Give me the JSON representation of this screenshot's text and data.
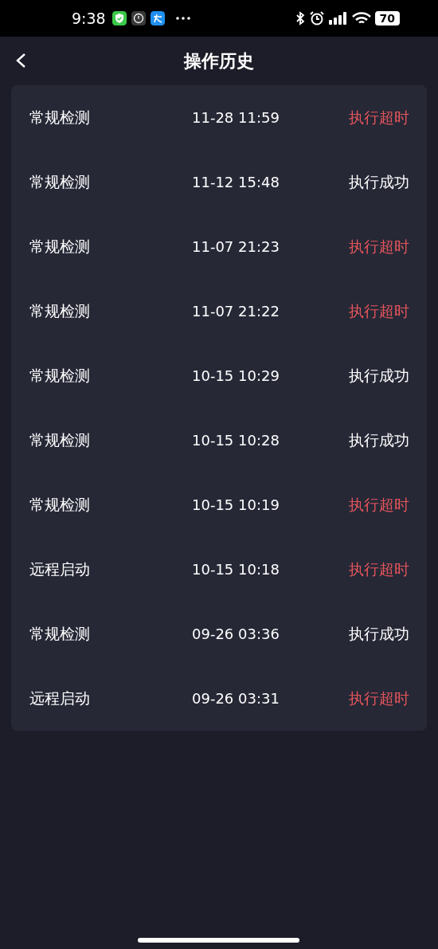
{
  "status_bar": {
    "time": "9:38",
    "battery": "70"
  },
  "header": {
    "title": "操作历史"
  },
  "records": [
    {
      "name": "常规检测",
      "time": "11-28 11:59",
      "status": "执行超时",
      "color": "#e5555b"
    },
    {
      "name": "常规检测",
      "time": "11-12 15:48",
      "status": "执行成功",
      "color": "#ffffff"
    },
    {
      "name": "常规检测",
      "time": "11-07 21:23",
      "status": "执行超时",
      "color": "#e5555b"
    },
    {
      "name": "常规检测",
      "time": "11-07 21:22",
      "status": "执行超时",
      "color": "#e5555b"
    },
    {
      "name": "常规检测",
      "time": "10-15 10:29",
      "status": "执行成功",
      "color": "#ffffff"
    },
    {
      "name": "常规检测",
      "time": "10-15 10:28",
      "status": "执行成功",
      "color": "#ffffff"
    },
    {
      "name": "常规检测",
      "time": "10-15 10:19",
      "status": "执行超时",
      "color": "#e5555b"
    },
    {
      "name": "远程启动",
      "time": "10-15 10:18",
      "status": "执行超时",
      "color": "#e5555b"
    },
    {
      "name": "常规检测",
      "time": "09-26 03:36",
      "status": "执行成功",
      "color": "#ffffff"
    },
    {
      "name": "远程启动",
      "time": "09-26 03:31",
      "status": "执行超时",
      "color": "#e5555b"
    }
  ]
}
